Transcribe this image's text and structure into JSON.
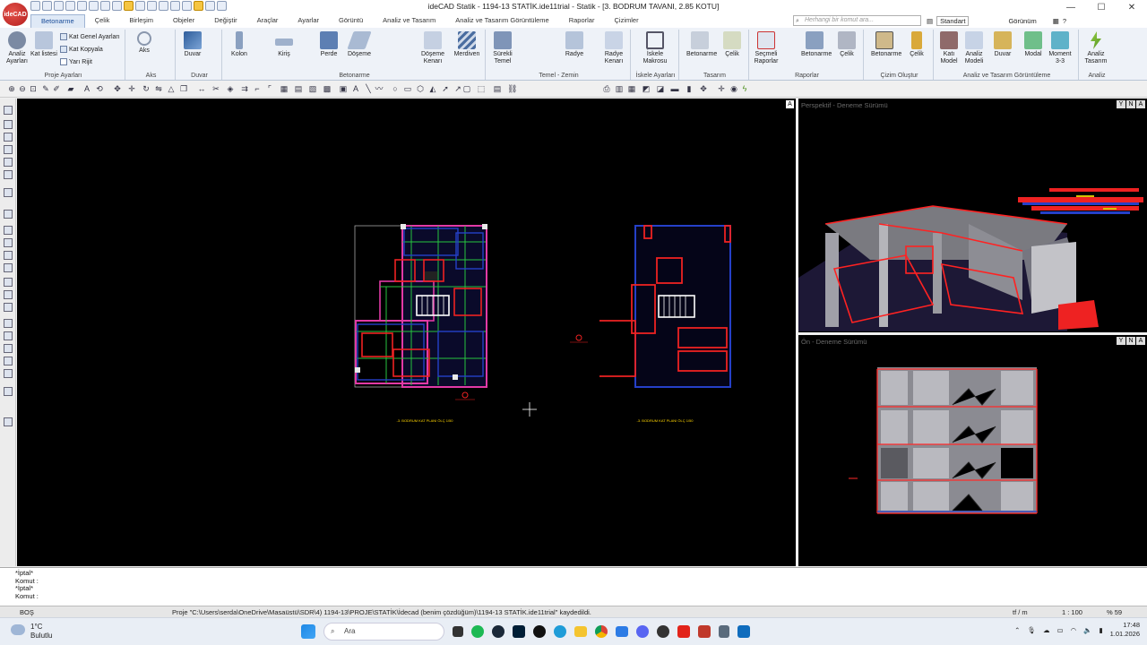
{
  "app": {
    "logo": "ideCAD",
    "title": "ideCAD Statik - 1194-13 STATİK.ide11trial - Statik - [3. BODRUM TAVANI,  2.85 KOTU]"
  },
  "tabs": [
    "Betonarme",
    "Çelik",
    "Birleşim",
    "Objeler",
    "Değiştir",
    "Araçlar",
    "Ayarlar",
    "Görüntü",
    "Analiz ve Tasarım",
    "Analiz ve Tasarım Görüntüleme",
    "Raporlar",
    "Çizimler"
  ],
  "search": {
    "placeholder": "Herhangi bir komut ara..."
  },
  "right_tools": {
    "style": "Standart",
    "view": "Görünüm"
  },
  "ribbon": {
    "groups": [
      {
        "title": "Proje Ayarları",
        "buttons": [
          "Analiz Ayarları",
          "Kat listesi"
        ],
        "small": [
          "Kat Genel Ayarları",
          "Kat Kopyala",
          "Yarı Rijit"
        ]
      },
      {
        "title": "Aks",
        "buttons": [
          "Aks"
        ]
      },
      {
        "title": "Duvar",
        "buttons": [
          "Duvar"
        ]
      },
      {
        "title": "Betonarme",
        "buttons": [
          "Kolon",
          "Kiriş",
          "Perde",
          "Döşeme",
          "Döşeme Kenarı",
          "Merdiven"
        ]
      },
      {
        "title": "Temel - Zemin",
        "buttons": [
          "Sürekli Temel",
          "Radye",
          "Radye Kenarı"
        ]
      },
      {
        "title": "İskele Ayarları",
        "buttons": [
          "İskele Makrosu"
        ]
      },
      {
        "title": "Tasarım",
        "buttons": [
          "Betonarme",
          "Çelik"
        ]
      },
      {
        "title": "Raporlar",
        "buttons": [
          "Seçmeli Raporlar",
          "Betonarme",
          "Çelik"
        ]
      },
      {
        "title": "Çizim Oluştur",
        "buttons": [
          "Betonarme",
          "Çelik"
        ]
      },
      {
        "title": "Analiz ve Tasarım Görüntüleme",
        "buttons": [
          "Katı Model",
          "Analiz Modeli",
          "Duvar",
          "Modal",
          "Moment 3-3"
        ]
      },
      {
        "title": "Analiz",
        "buttons": [
          "Analiz Tasarım"
        ]
      }
    ]
  },
  "viewports": {
    "plan_label_1": "-3. BODRUM KAT PLANI ÖLÇ 1/50",
    "plan_label_2": "-3. BODRUM KAT PLANI ÖLÇ 1/50",
    "perspective": "Perspektif - Deneme Sürümü",
    "front": "Ön - Deneme Sürümü",
    "corner": "A",
    "controls": [
      "Y",
      "N",
      "A"
    ]
  },
  "command": {
    "lines": [
      "*İptal*",
      "Komut :",
      "*İptal*",
      "Komut :"
    ]
  },
  "status": {
    "mode": "BOŞ",
    "message": "Proje \"C:\\Users\\serda\\OneDrive\\Masaüstü\\SDR\\4) 1194-13\\PROJE\\STATİK\\İdecad (benim çözdüğüm)\\1194-13 STATİK.ide11trial\" kaydedildi.",
    "unit": "tf / m",
    "scale": "1 : 100",
    "zoom": "% 59"
  },
  "taskbar": {
    "temperature": "1°C",
    "weather": "Bulutlu",
    "search": "Ara",
    "time": "17:48",
    "date": "1.01.2026"
  }
}
